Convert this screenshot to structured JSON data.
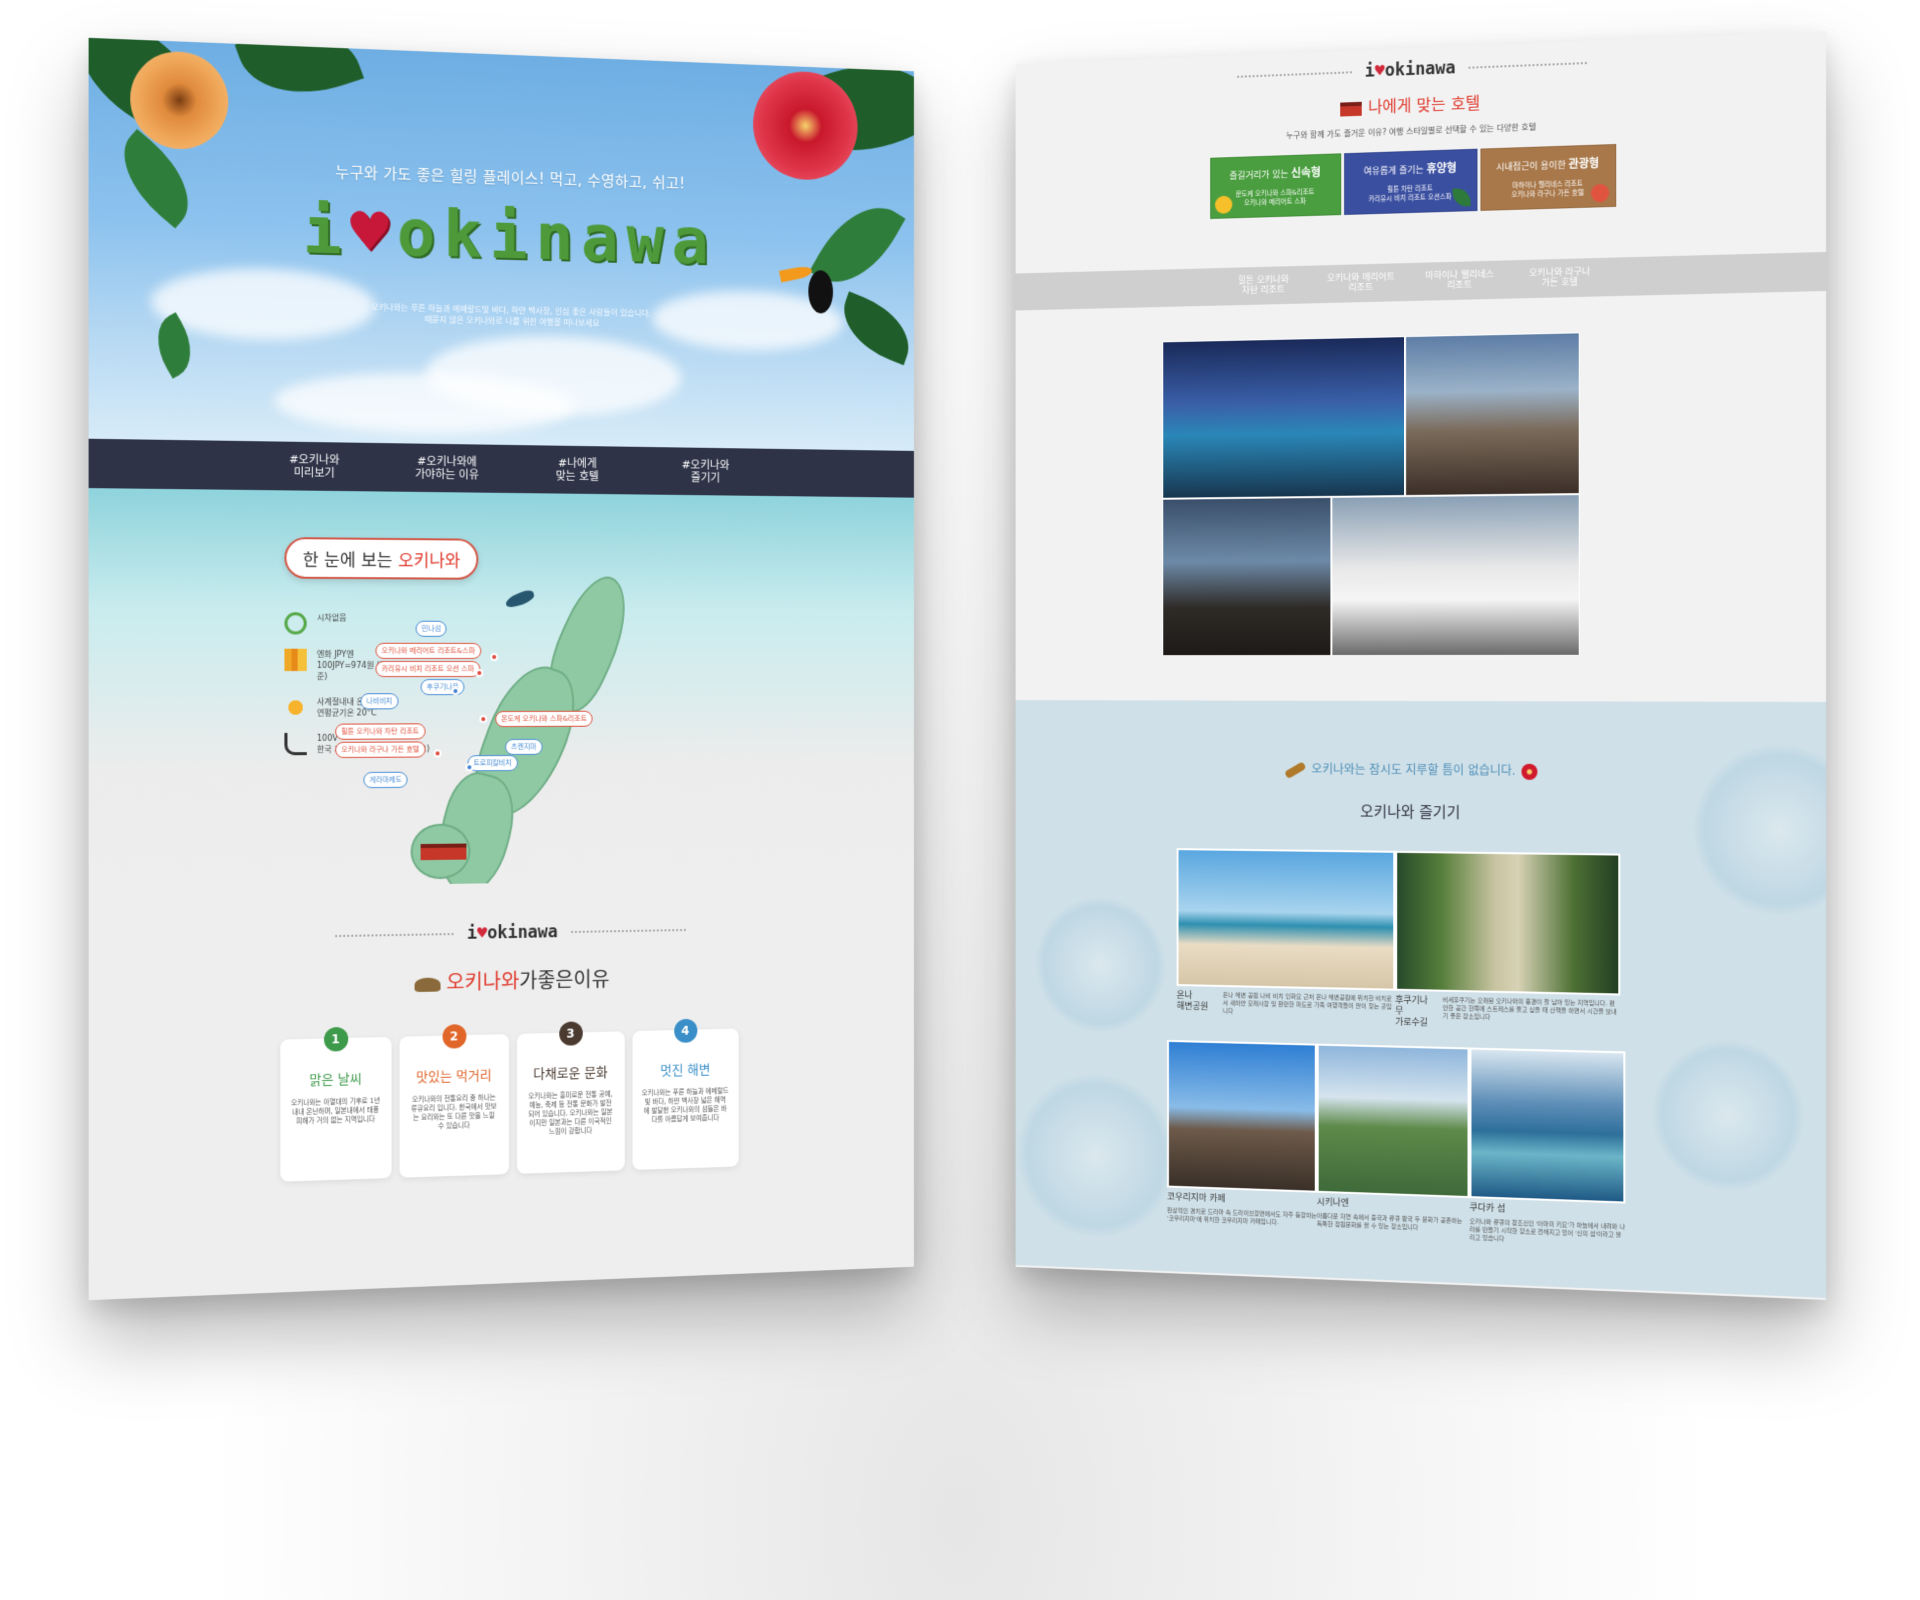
{
  "left": {
    "hero": {
      "subtitle": "누구와 가도 좋은 힐링 플레이스! 먹고, 수영하고, 쉬고!",
      "logo_prefix": "i",
      "logo_heart": "♥",
      "logo_word": "okinawa",
      "description_line1": "오키나와는 푸른 하늘과 에메랄드빛 바다, 하얀 백사장, 인심 좋은 사람들이 있습니다.",
      "description_line2": "때묻지 않은 오키나와로 나를 위한 여행을 떠나보세요"
    },
    "nav": [
      "#오키나와\n미리보기",
      "#오키나와에\n가야하는 이유",
      "#나에게\n맞는 호텔",
      "#오키나와\n즐기기"
    ],
    "map_section": {
      "title_prefix": "한 눈에 보는",
      "title_highlight": "오키나와",
      "info": [
        {
          "icon": "clock-icon",
          "text": "시차없음"
        },
        {
          "icon": "money-icon",
          "text": "엔화 JPY엔\n100JPY=974원 (2018년5월기준)"
        },
        {
          "icon": "sun-icon",
          "text": "사계절내내 온난한 기후\n연평균기온 20°C"
        },
        {
          "icon": "plug-icon",
          "text": "100V\n한국 제품 사용가능 (어댑터 필요)"
        }
      ],
      "tags": [
        {
          "text": "민나섬",
          "color": "blue"
        },
        {
          "text": "오키나와 메리어트 리조트&스파",
          "color": "red"
        },
        {
          "text": "카리유시 비치 리조트 오션 스파",
          "color": "red"
        },
        {
          "text": "후쿠기나무",
          "color": "blue"
        },
        {
          "text": "나비비치",
          "color": "blue"
        },
        {
          "text": "온도케 오키나와 스파&리조트",
          "color": "red"
        },
        {
          "text": "힐튼 오키나와 차탄 리조트",
          "color": "red"
        },
        {
          "text": "오키나와 라구나 가든 호텔",
          "color": "red"
        },
        {
          "text": "츠켄지마",
          "color": "blue"
        },
        {
          "text": "트로피칼비치",
          "color": "blue"
        },
        {
          "text": "게라마제도",
          "color": "blue"
        }
      ]
    },
    "reasons": {
      "logo_prefix": "i",
      "logo_heart": "♥",
      "logo_word": "okinawa",
      "title_highlight": "오키나와",
      "title_rest": "가좋은이유",
      "cards": [
        {
          "num": "1",
          "title": "맑은 날씨",
          "color": "#3d9a4a",
          "desc": "오키나와는 아열대의 기후로 1년 내내 온난하며, 일본내에서 태풍 피해가 거의 없는 지역입니다"
        },
        {
          "num": "2",
          "title": "맛있는 먹거리",
          "color": "#e0662a",
          "desc": "오키나와의 전통요리 중 하나는 류큐요리 입니다. 한국에서 맛보는 요리와는 또 다른 맛을 느낄 수 있습니다"
        },
        {
          "num": "3",
          "title": "다채로운 문화",
          "color": "#4a3a30",
          "desc": "오키나와는 흥미로운 전통 공예, 예능, 축제 등 전통 문화가 발전되어 있습니다. 오키나와는 일본이지만 일본과는 다른 이국적인 느낌이 강합니다"
        },
        {
          "num": "4",
          "title": "멋진 해변",
          "color": "#3a8fc8",
          "desc": "오키나와는 푸른 하늘과 에메랄드빛 바다, 하얀 백사장 넓은 해역에 발달한 오키나와의 섬들은 바다를 아름답게 보여줍니다"
        }
      ]
    }
  },
  "right": {
    "header": {
      "logo_prefix": "i",
      "logo_heart": "♥",
      "logo_word": "okinawa",
      "title_prefix": "나에게 맞는",
      "title_highlight": "호텔",
      "subtitle": "누구와 함께 가도 즐거운 이유? 여행 스타일별로 선택할 수 있는 다양한 호텔"
    },
    "hotel_types": [
      {
        "lead": "즐길거리가 있는",
        "type": "신속형",
        "color": "#4a9e3f",
        "desc": "문도케 오키나와 스파&리조트\n오키나와 메리어트 스파"
      },
      {
        "lead": "여유롭게 즐기는",
        "type": "휴양형",
        "color": "#3a4fa0",
        "desc": "힐튼 차탄 리조트\n카리유시 비치 리조트 오션스파"
      },
      {
        "lead": "시내접근이 용이한",
        "type": "관광형",
        "color": "#a8784a",
        "desc": "마하이나 웰리네스 리조트\n오키나와 라구나 가든 호텔"
      }
    ],
    "hotel_nav": [
      "힐튼 오키나와\n차탄 리조트",
      "오키나와 메리어트\n리조트",
      "마하이나 웰리네스\n리조트",
      "오키나와 라구나\n가든 호텔"
    ],
    "enjoy": {
      "subtitle": "오키나와는 잠시도 지루할 틈이 없습니다.",
      "title": "오키나와 즐기기",
      "items": [
        {
          "name": "온나\n해변공원",
          "desc": "온나 해변 공원 나비 비치 인화요 근처 온나 해변공원에 위치한 비치로서 새하얀 모래사장 및 완만한 파도로 가족 여행객들이 많이 찾는 곳입니다"
        },
        {
          "name": "후쿠기나무\n가로수길",
          "desc": "비세후쿠기는 오래된 오키나와의 풍경이 잘 남아 있는 지역입니다. 편안한 공간 한쪽에 스트레스를 풀고 싶을 때 산책을 하면서 시간을 보내기 좋은 장소입니다"
        },
        {
          "name": "코우리지마 카페",
          "desc": "환상적인 경치로 드라마 속 드라이브장면에서도 자주 등장하는 '코우리지마'에 위치한 코우리지마 카페입니다."
        },
        {
          "name": "시키나엔",
          "desc": "아름다운 자연 속에서 중국과 류큐 왕국 두 문화가 공존하는 독특한 정원문화를 볼 수 있는 장소입니다"
        },
        {
          "name": "쿠다카 섬",
          "desc": "오키나와 류큐의 창조신인 '아마미 키요'가 하늘에서 내려와 나라를 만들기 시작한 장소로 전해지고 있어 '신의 섬'이라고 불리고 있습니다"
        }
      ]
    }
  },
  "colors": {
    "accent_red": "#e0392c",
    "nav_dark": "#2e3347",
    "enjoy_bg": "#cfe0e8"
  }
}
